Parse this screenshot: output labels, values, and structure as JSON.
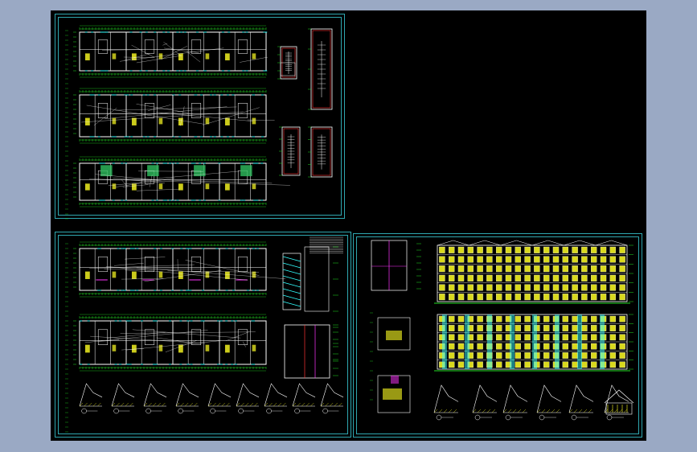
{
  "app": {
    "canvas_background": "#000000",
    "workspace_background": "#9aa9c4",
    "frame_color": "#2fa7b0"
  },
  "sheets": [
    {
      "id": "sheet-1",
      "content": "floor-plans-and-stair-details"
    },
    {
      "id": "sheet-2",
      "content": "floor-plans-and-wall-details"
    },
    {
      "id": "sheet-3",
      "content": "elevations-sections-and-details"
    }
  ],
  "colors": {
    "wall": "#ffffff",
    "grid": "#22dd22",
    "accent_yellow": "#ffff22",
    "accent_magenta": "#ff33ff",
    "accent_cyan": "#33ffff",
    "accent_red": "#ff3333"
  }
}
